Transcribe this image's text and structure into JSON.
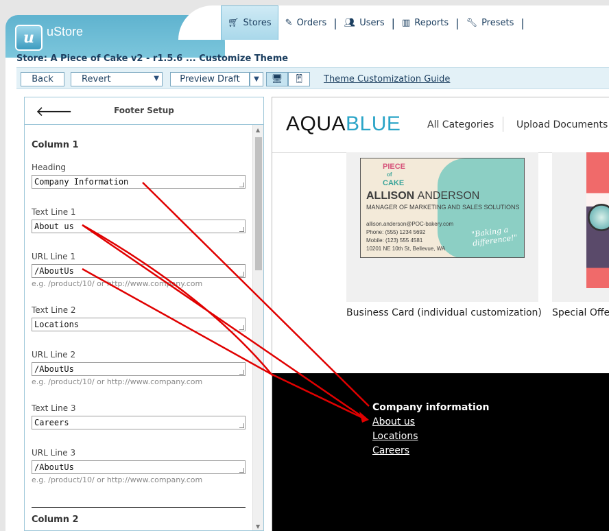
{
  "app": {
    "name": "uStore",
    "logo_letter": "u"
  },
  "nav": {
    "stores": "Stores",
    "orders": "Orders",
    "users": "Users",
    "reports": "Reports",
    "presets": "Presets"
  },
  "store_title": "Store: A Piece of Cake v2 - r1.5.6 ... Customize Theme",
  "toolbar": {
    "back": "Back",
    "revert": "Revert",
    "preview_draft": "Preview Draft",
    "guide": "Theme Customization Guide"
  },
  "panel": {
    "title": "Footer Setup",
    "column1": "Column 1",
    "column2": "Column 2",
    "fields": [
      {
        "label": "Heading",
        "value": "Company Information"
      },
      {
        "label": "Text Line 1",
        "value": "About us"
      },
      {
        "label": "URL Line 1",
        "value": "/AboutUs",
        "hint": "e.g. /product/10/ or http://www.company.com"
      },
      {
        "label": "Text Line 2",
        "value": "Locations"
      },
      {
        "label": "URL Line 2",
        "value": "/AboutUs",
        "hint": "e.g. /product/10/ or http://www.company.com"
      },
      {
        "label": "Text Line 3",
        "value": "Careers"
      },
      {
        "label": "URL Line 3",
        "value": "/AboutUs",
        "hint": "e.g. /product/10/ or http://www.company.com"
      }
    ]
  },
  "preview": {
    "brand_dark": "AQUA",
    "brand_blue": "BLUE",
    "nav": [
      "All Categories",
      "Upload Documents"
    ],
    "card": {
      "logo_top": "PIECE",
      "logo_of": "of",
      "logo_bottom": "CAKE",
      "first_name": "ALLISON",
      "last_name": "ANDERSON",
      "role": "MANAGER OF MARKETING AND SALES SOLUTIONS",
      "email": "allison.anderson@POC-bakery.com",
      "phone": "Phone: (555) 1234 5692",
      "mobile": "Mobile: (123) 555 4581",
      "address": "10201 NE 10th St, Bellevue, WA",
      "slogan_1": "\"Baking a",
      "slogan_2": "difference!\""
    },
    "products": [
      "Business Card (individual customization)",
      "Special Offer"
    ],
    "footer": {
      "heading": "Company information",
      "links": [
        "About us",
        "Locations",
        "Careers"
      ]
    }
  },
  "colors": {
    "accent": "#2aa4c7",
    "nav_text": "#1c3f60",
    "annotation": "#e00000"
  }
}
